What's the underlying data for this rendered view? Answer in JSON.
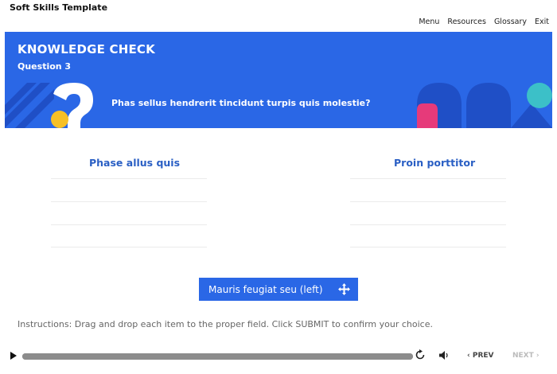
{
  "app": {
    "title": "Soft Skills Template"
  },
  "nav": {
    "items": [
      "Menu",
      "Resources",
      "Glossary",
      "Exit"
    ]
  },
  "banner": {
    "heading": "KNOWLEDGE CHECK",
    "question_number": "Question 3",
    "question_text": "Phas sellus hendrerit tincidunt turpis quis molestie?",
    "colors": {
      "background": "#2a67e6",
      "yellow": "#f6c026",
      "pink": "#e63a7a",
      "teal": "#3cc0c8",
      "dark_blue": "#1f4fc6"
    }
  },
  "columns": [
    {
      "heading": "Phase allus quis"
    },
    {
      "heading": "Proin porttitor"
    }
  ],
  "drag_item": {
    "label": "Mauris feugiat seu (left)",
    "icon": "move-icon"
  },
  "instructions": "Instructions: Drag and drop each item to the proper field. Click SUBMIT to confirm your choice.",
  "player": {
    "progress": 1.0,
    "prev_label": "PREV",
    "next_label": "NEXT",
    "icons": [
      "play-icon",
      "replay-icon",
      "volume-icon",
      "chevron-left-icon",
      "chevron-right-icon"
    ]
  }
}
